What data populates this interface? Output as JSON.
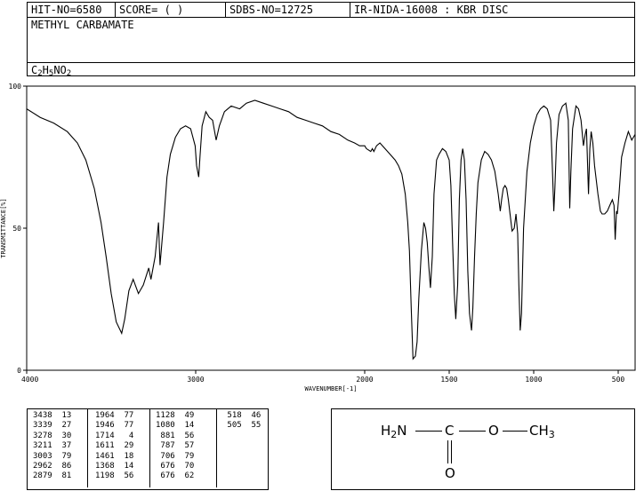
{
  "header": {
    "hit_no": "HIT-NO=6580",
    "score": "SCORE=  (   )",
    "sdbs_no": "SDBS-NO=12725",
    "ir_info": "IR-NIDA-16008 : KBR DISC",
    "compound_name": "METHYL CARBAMATE",
    "formula": {
      "c": "C",
      "c_n": "2",
      "h": "H",
      "h_n": "5",
      "rest": "NO",
      "o_n": "2"
    }
  },
  "chart_data": {
    "type": "line",
    "xlabel": "WAVENUMBER[-1]",
    "ylabel": "TRANSMITTANCE[%]",
    "xlim": [
      4000,
      400
    ],
    "ylim": [
      0,
      100
    ],
    "x_ticks": [
      4000,
      3000,
      2000,
      1500,
      1000,
      500
    ],
    "y_ticks": [
      0,
      50,
      100
    ],
    "series": [
      {
        "points": [
          [
            4000,
            92
          ],
          [
            3920,
            89
          ],
          [
            3840,
            87
          ],
          [
            3760,
            84
          ],
          [
            3700,
            80
          ],
          [
            3650,
            74
          ],
          [
            3600,
            64
          ],
          [
            3560,
            52
          ],
          [
            3530,
            40
          ],
          [
            3500,
            27
          ],
          [
            3470,
            17
          ],
          [
            3438,
            13
          ],
          [
            3420,
            18
          ],
          [
            3395,
            28
          ],
          [
            3370,
            32
          ],
          [
            3339,
            27
          ],
          [
            3310,
            30
          ],
          [
            3278,
            36
          ],
          [
            3265,
            32
          ],
          [
            3240,
            40
          ],
          [
            3220,
            52
          ],
          [
            3211,
            37
          ],
          [
            3190,
            52
          ],
          [
            3170,
            68
          ],
          [
            3150,
            76
          ],
          [
            3120,
            82
          ],
          [
            3090,
            85
          ],
          [
            3060,
            86
          ],
          [
            3030,
            85
          ],
          [
            3003,
            79
          ],
          [
            2995,
            72
          ],
          [
            2982,
            68
          ],
          [
            2975,
            75
          ],
          [
            2962,
            86
          ],
          [
            2940,
            91
          ],
          [
            2920,
            89
          ],
          [
            2900,
            88
          ],
          [
            2879,
            81
          ],
          [
            2860,
            86
          ],
          [
            2830,
            91
          ],
          [
            2790,
            93
          ],
          [
            2740,
            92
          ],
          [
            2700,
            94
          ],
          [
            2650,
            95
          ],
          [
            2600,
            94
          ],
          [
            2550,
            93
          ],
          [
            2500,
            92
          ],
          [
            2450,
            91
          ],
          [
            2400,
            89
          ],
          [
            2350,
            88
          ],
          [
            2300,
            87
          ],
          [
            2250,
            86
          ],
          [
            2200,
            84
          ],
          [
            2150,
            83
          ],
          [
            2100,
            81
          ],
          [
            2060,
            80
          ],
          [
            2030,
            79
          ],
          [
            2000,
            79
          ],
          [
            1990,
            78
          ],
          [
            1964,
            77
          ],
          [
            1955,
            78
          ],
          [
            1946,
            77
          ],
          [
            1930,
            79
          ],
          [
            1910,
            80
          ],
          [
            1880,
            78
          ],
          [
            1850,
            76
          ],
          [
            1820,
            74
          ],
          [
            1800,
            72
          ],
          [
            1780,
            69
          ],
          [
            1760,
            62
          ],
          [
            1745,
            52
          ],
          [
            1735,
            42
          ],
          [
            1725,
            22
          ],
          [
            1714,
            4
          ],
          [
            1700,
            5
          ],
          [
            1690,
            10
          ],
          [
            1680,
            25
          ],
          [
            1665,
            42
          ],
          [
            1650,
            52
          ],
          [
            1640,
            50
          ],
          [
            1630,
            45
          ],
          [
            1620,
            36
          ],
          [
            1611,
            29
          ],
          [
            1600,
            40
          ],
          [
            1590,
            62
          ],
          [
            1575,
            74
          ],
          [
            1560,
            76
          ],
          [
            1540,
            78
          ],
          [
            1520,
            77
          ],
          [
            1500,
            74
          ],
          [
            1490,
            65
          ],
          [
            1480,
            45
          ],
          [
            1470,
            27
          ],
          [
            1461,
            18
          ],
          [
            1450,
            30
          ],
          [
            1440,
            60
          ],
          [
            1430,
            74
          ],
          [
            1420,
            78
          ],
          [
            1410,
            74
          ],
          [
            1400,
            60
          ],
          [
            1390,
            35
          ],
          [
            1380,
            20
          ],
          [
            1368,
            14
          ],
          [
            1360,
            22
          ],
          [
            1350,
            40
          ],
          [
            1340,
            55
          ],
          [
            1330,
            66
          ],
          [
            1310,
            74
          ],
          [
            1290,
            77
          ],
          [
            1270,
            76
          ],
          [
            1250,
            74
          ],
          [
            1230,
            70
          ],
          [
            1210,
            62
          ],
          [
            1198,
            56
          ],
          [
            1190,
            60
          ],
          [
            1180,
            64
          ],
          [
            1170,
            65
          ],
          [
            1160,
            64
          ],
          [
            1150,
            60
          ],
          [
            1140,
            55
          ],
          [
            1128,
            49
          ],
          [
            1115,
            50
          ],
          [
            1105,
            55
          ],
          [
            1095,
            48
          ],
          [
            1088,
            30
          ],
          [
            1080,
            14
          ],
          [
            1072,
            20
          ],
          [
            1060,
            50
          ],
          [
            1040,
            70
          ],
          [
            1020,
            80
          ],
          [
            1000,
            86
          ],
          [
            980,
            90
          ],
          [
            960,
            92
          ],
          [
            940,
            93
          ],
          [
            920,
            92
          ],
          [
            900,
            88
          ],
          [
            890,
            72
          ],
          [
            881,
            56
          ],
          [
            875,
            64
          ],
          [
            865,
            80
          ],
          [
            850,
            90
          ],
          [
            830,
            93
          ],
          [
            810,
            94
          ],
          [
            795,
            88
          ],
          [
            787,
            57
          ],
          [
            780,
            70
          ],
          [
            770,
            85
          ],
          [
            750,
            93
          ],
          [
            735,
            92
          ],
          [
            720,
            88
          ],
          [
            706,
            79
          ],
          [
            695,
            83
          ],
          [
            688,
            85
          ],
          [
            676,
            62
          ],
          [
            668,
            78
          ],
          [
            660,
            84
          ],
          [
            650,
            80
          ],
          [
            640,
            72
          ],
          [
            620,
            62
          ],
          [
            605,
            56
          ],
          [
            595,
            55
          ],
          [
            580,
            55
          ],
          [
            565,
            56
          ],
          [
            550,
            58
          ],
          [
            535,
            60
          ],
          [
            525,
            58
          ],
          [
            518,
            46
          ],
          [
            510,
            56
          ],
          [
            505,
            55
          ],
          [
            495,
            62
          ],
          [
            480,
            75
          ],
          [
            460,
            80
          ],
          [
            440,
            84
          ],
          [
            420,
            81
          ],
          [
            400,
            83
          ]
        ]
      }
    ],
    "peak_table": [
      [
        3438,
        13
      ],
      [
        3339,
        27
      ],
      [
        3278,
        30
      ],
      [
        3211,
        37
      ],
      [
        3003,
        79
      ],
      [
        2962,
        86
      ],
      [
        2879,
        81
      ],
      [
        1964,
        77
      ],
      [
        1946,
        77
      ],
      [
        1714,
        4
      ],
      [
        1611,
        29
      ],
      [
        1461,
        18
      ],
      [
        1368,
        14
      ],
      [
        1198,
        56
      ],
      [
        1128,
        49
      ],
      [
        1080,
        14
      ],
      [
        881,
        56
      ],
      [
        787,
        57
      ],
      [
        706,
        79
      ],
      [
        676,
        70
      ],
      [
        676,
        62
      ],
      [
        518,
        46
      ],
      [
        505,
        55
      ]
    ]
  },
  "structure": {
    "nh2_n": "N",
    "nh2_h": "H",
    "nh2_sub": "2",
    "carbon": "C",
    "oxygen_ether": "O",
    "methyl": "CH",
    "methyl_sub": "3",
    "oxygen_carbonyl": "O"
  }
}
